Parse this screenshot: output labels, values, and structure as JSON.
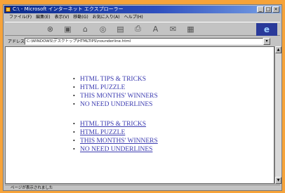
{
  "window": {
    "title": "C:\\ - Microsoft インターネット エクスプローラー"
  },
  "menu": [
    "ファイル(F)",
    "編集(E)",
    "表示(V)",
    "移動(G)",
    "お気に入り(A)",
    "ヘルプ(H)"
  ],
  "toolbar": {
    "icons": [
      "back-icon",
      "forward-icon",
      "stop-icon",
      "refresh-icon",
      "home-icon",
      "search-icon",
      "favorites-icon",
      "print-icon",
      "font-icon",
      "mail-icon",
      "edit-icon"
    ]
  },
  "address": {
    "label": "アドレス",
    "value": "C:\\WINDOWS\\デスクトップ\\HTMLTIPS\\nounderline.html"
  },
  "list_normal": [
    "HTML TIPS & TRICKS",
    "HTML PUZZLE",
    "THIS MONTHS' WINNERS",
    "NO NEED UNDERLINES"
  ],
  "list_underlined": [
    "HTML TIPS & TRICKS",
    "HTML PUZZLE",
    "THIS MONTHS' WINNERS",
    "NO NEED UNDERLINES"
  ],
  "status": {
    "text": "ページが表示されました"
  },
  "colors": {
    "background": "#f6a33a",
    "link": "#3a3ab0",
    "titlebar": "#0a2a8a"
  }
}
